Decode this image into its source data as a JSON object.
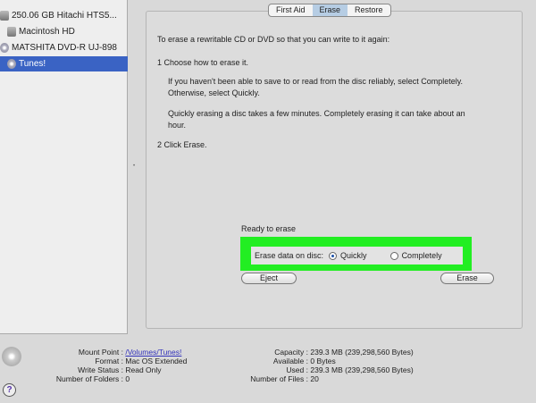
{
  "sidebar": {
    "items": [
      {
        "label": "250.06 GB Hitachi HTS5...",
        "icon": "hard-drive-icon"
      },
      {
        "label": "Macintosh HD",
        "icon": "volume-icon"
      },
      {
        "label": "MATSHITA DVD-R UJ-898",
        "icon": "optical-drive-icon"
      },
      {
        "label": "Tunes!",
        "icon": "disc-icon",
        "selected": true
      }
    ]
  },
  "tabs": [
    {
      "label": "First Aid"
    },
    {
      "label": "Erase",
      "active": true
    },
    {
      "label": "Restore"
    }
  ],
  "erase": {
    "intro": "To erase a rewritable CD or DVD so that you can write to it again:",
    "step1": "1  Choose how to erase it.",
    "para1a": "If you haven't been able to save to or read from the disc reliably, select Completely.",
    "para1b": "Otherwise, select Quickly.",
    "para2a": "Quickly erasing a disc takes a few minutes. Completely erasing it can take about an",
    "para2b": "hour.",
    "step2": "2  Click Erase.",
    "status": "Ready to erase",
    "option_label": "Erase data on disc:",
    "option_quickly": "Quickly",
    "option_completely": "Completely",
    "selected_option": "Quickly",
    "eject": "Eject",
    "erase": "Erase",
    "highlight_color": "#22ee22"
  },
  "info": {
    "mount_point_label": "Mount Point :",
    "mount_point": "/Volumes/Tunes!",
    "format_label": "Format :",
    "format": "Mac OS Extended",
    "write_status_label": "Write Status :",
    "write_status": "Read Only",
    "folders_label": "Number of Folders :",
    "folders": "0",
    "capacity_label": "Capacity :",
    "capacity": "239.3 MB (239,298,560 Bytes)",
    "available_label": "Available :",
    "available": "0 Bytes",
    "used_label": "Used :",
    "used": "239.3 MB (239,298,560 Bytes)",
    "files_label": "Number of Files :",
    "files": "20"
  },
  "help": "?"
}
